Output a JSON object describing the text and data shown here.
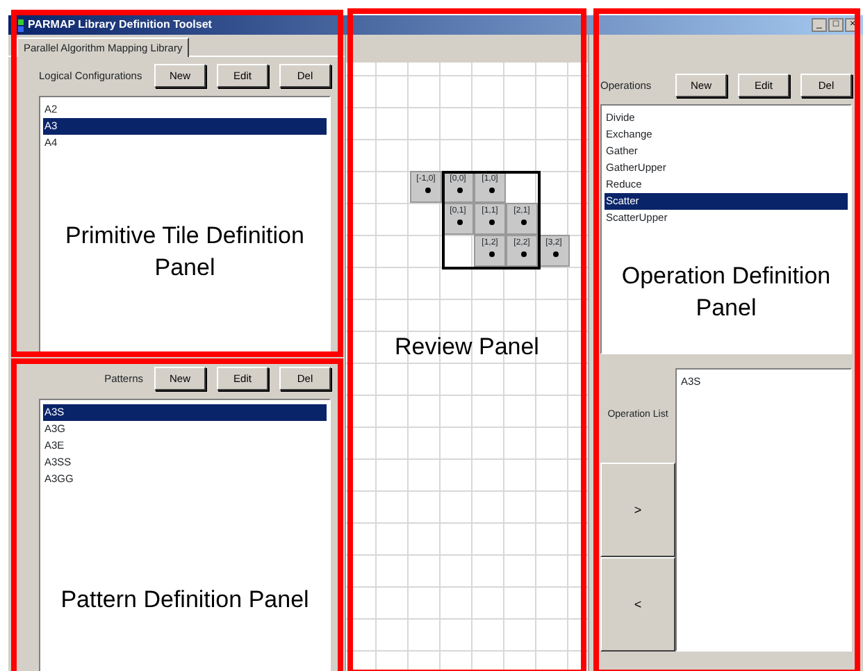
{
  "window": {
    "title": "PARMAP Library Definition Toolset",
    "controls": [
      "_",
      "□",
      "×"
    ]
  },
  "tab": {
    "label": "Parallel Algorithm Mapping Library",
    "selected": true
  },
  "configurations": {
    "label": "Logical Configurations",
    "buttons": [
      "New",
      "Edit",
      "Del"
    ],
    "items": [
      {
        "label": "A2",
        "selected": false
      },
      {
        "label": "A3",
        "selected": true
      },
      {
        "label": "A4",
        "selected": false
      }
    ]
  },
  "patterns": {
    "label": "Patterns",
    "buttons": [
      "New",
      "Edit",
      "Del"
    ],
    "items": [
      {
        "label": "A3S",
        "selected": true
      },
      {
        "label": "A3G",
        "selected": false
      },
      {
        "label": "A3E",
        "selected": false
      },
      {
        "label": "A3SS",
        "selected": false
      },
      {
        "label": "A3GG",
        "selected": false
      }
    ]
  },
  "review": {
    "tile_rows": [
      {
        "cells": [
          "[-1,0]",
          "[0,0]",
          "[1,0]"
        ]
      },
      {
        "cells": [
          "[0,1]",
          "[1,1]",
          "[2,1]"
        ]
      },
      {
        "cells": [
          "[1,2]",
          "[2,2]",
          "[3,2]"
        ]
      }
    ]
  },
  "operations": {
    "label": "Operations",
    "buttons": [
      "New",
      "Edit",
      "Del"
    ],
    "items": [
      {
        "label": "Divide",
        "selected": false
      },
      {
        "label": "Exchange",
        "selected": false
      },
      {
        "label": "Gather",
        "selected": false
      },
      {
        "label": "GatherUpper",
        "selected": false
      },
      {
        "label": "Reduce",
        "selected": false
      },
      {
        "label": "Scatter",
        "selected": true
      },
      {
        "label": "ScatterUpper",
        "selected": false
      }
    ],
    "list_label": "Operation List",
    "list_items": [
      "A3S"
    ],
    "move_buttons": [
      ">",
      "<"
    ]
  },
  "annotations": [
    {
      "text": "Primitive Tile Definition Panel"
    },
    {
      "text": "Pattern Definition Panel"
    },
    {
      "text": "Review Panel"
    },
    {
      "text": "Operation Definition Panel"
    }
  ]
}
